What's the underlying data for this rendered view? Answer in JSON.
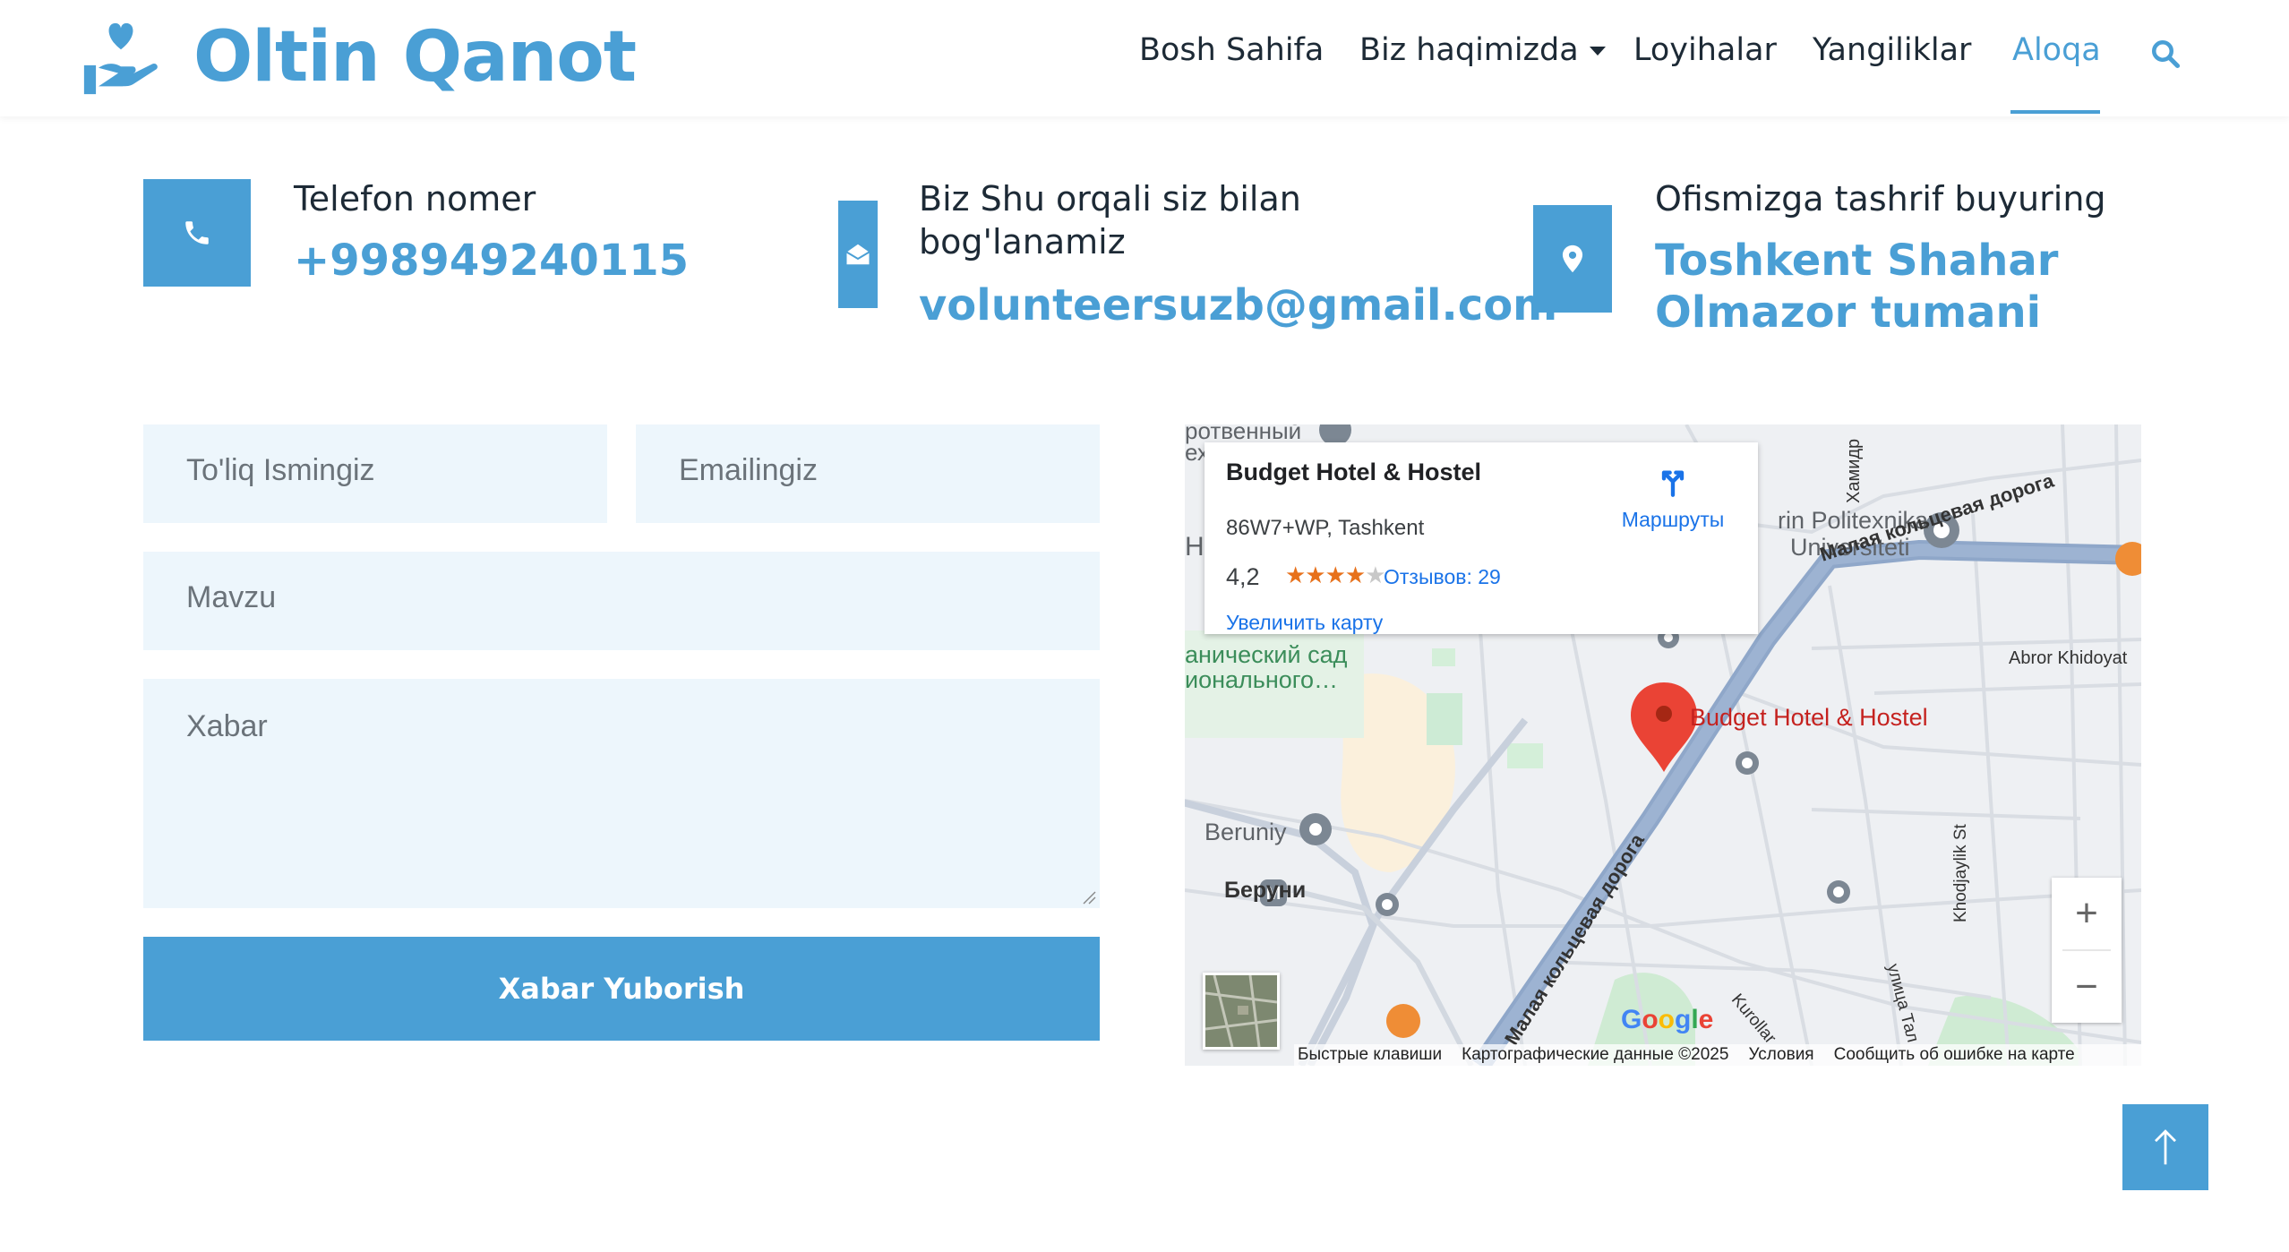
{
  "brand": {
    "name": "Oltin Qanot"
  },
  "nav": {
    "items": [
      {
        "label": "Bosh Sahifa"
      },
      {
        "label": "Biz haqimizda"
      },
      {
        "label": "Loyihalar"
      },
      {
        "label": "Yangiliklar"
      },
      {
        "label": "Aloqa"
      }
    ],
    "active": "Aloqa"
  },
  "contact": {
    "phone": {
      "title": "Telefon nomer",
      "value": "+998949240115"
    },
    "email": {
      "title_line1": "Biz Shu orqali siz bilan",
      "title_line2": "bog'lanamiz",
      "value": "volunteersuzb@gmail.com"
    },
    "address": {
      "title": "Ofismizga tashrif buyuring",
      "value_line1": "Toshkent Shahar",
      "value_line2": "Olmazor tumani"
    }
  },
  "form": {
    "name_placeholder": "To'liq Ismingiz",
    "email_placeholder": "Emailingiz",
    "subject_placeholder": "Mavzu",
    "message_placeholder": "Xabar",
    "submit_label": "Xabar Yuborish"
  },
  "map": {
    "place_title": "Budget Hotel & Hostel",
    "address": "86W7+WP, Tashkent",
    "rating": "4,2",
    "rating_value": 4.2,
    "stars": "★★★★",
    "stars_empty": "★",
    "reviews": "Отзывов: 29",
    "directions": "Маршруты",
    "enlarge": "Увеличить карту",
    "marker_label": "Budget Hotel & Hostel",
    "labels": {
      "politech": "rin Politexnika",
      "univ": "Universiteti",
      "ring_road_top": "Малая кольцевая дорога",
      "ring_road_diag": "Малая кольцевая дорога",
      "abror": "Abror Khidoyat",
      "hamid": "Хамидр",
      "garden1": "анический сад",
      "garden2": "ионального…",
      "beruniy_lat": "Beruniy",
      "beruniy_cyr": "Беруни",
      "khodjaylik": "Khodjaylik St",
      "tal": "улица Тал",
      "kurollar": "Kurollar",
      "top_cut1": "ротвенный",
      "top_cut2": "ехнический",
      "h": "H"
    },
    "attribution": {
      "shortcuts": "Быстрые клавиши",
      "data": "Картографические данные ©2025",
      "terms": "Условия",
      "report": "Сообщить об ошибке на карте"
    },
    "google": "Google",
    "zoom_in": "+",
    "zoom_out": "−"
  },
  "colors": {
    "accent": "#4a9fd5",
    "field_bg": "#edf6fc",
    "text_dark": "#1d2a36"
  },
  "icons": {
    "brand": "hand-heart-icon",
    "search": "search-icon",
    "phone": "phone-icon",
    "email": "envelope-open-icon",
    "location": "map-pin-icon",
    "back_to_top": "arrow-up-icon"
  }
}
